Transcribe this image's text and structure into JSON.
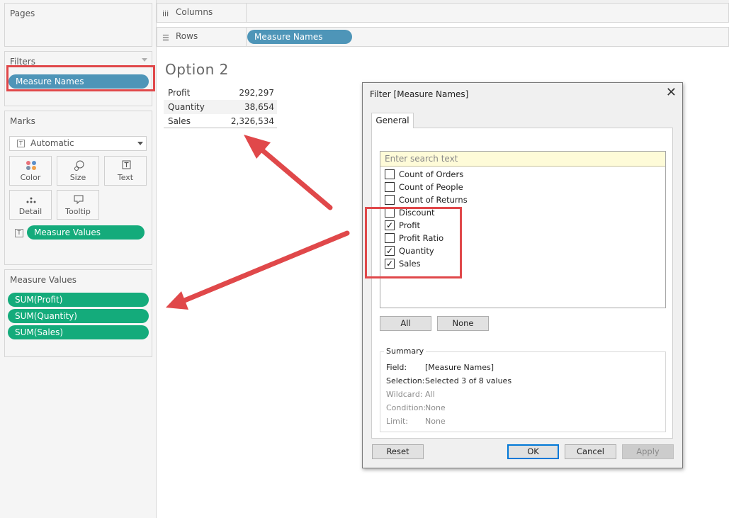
{
  "left_pane": {
    "pages": {
      "title": "Pages"
    },
    "filters": {
      "title": "Filters",
      "pill": "Measure Names"
    },
    "marks": {
      "title": "Marks",
      "mark_type": "Automatic",
      "buttons": [
        {
          "label": "Color",
          "icon": "color-dots-icon"
        },
        {
          "label": "Size",
          "icon": "size-icon"
        },
        {
          "label": "Text",
          "icon": "text-icon"
        },
        {
          "label": "Detail",
          "icon": "detail-icon"
        },
        {
          "label": "Tooltip",
          "icon": "tooltip-icon"
        }
      ],
      "text_pill": "Measure Values"
    },
    "measure_values": {
      "title": "Measure Values",
      "pills": [
        "SUM(Profit)",
        "SUM(Quantity)",
        "SUM(Sales)"
      ]
    }
  },
  "shelves": {
    "columns": {
      "label": "Columns"
    },
    "rows": {
      "label": "Rows",
      "pill": "Measure Names"
    }
  },
  "worksheet": {
    "title": "Option 2",
    "rows": [
      {
        "name": "Profit",
        "value": "292,297"
      },
      {
        "name": "Quantity",
        "value": "38,654"
      },
      {
        "name": "Sales",
        "value": "2,326,534"
      }
    ]
  },
  "dialog": {
    "title": "Filter [Measure Names]",
    "tab": "General",
    "search_placeholder": "Enter search text",
    "items": [
      {
        "label": "Count of Orders",
        "checked": false
      },
      {
        "label": "Count of People",
        "checked": false
      },
      {
        "label": "Count of Returns",
        "checked": false
      },
      {
        "label": "Discount",
        "checked": false
      },
      {
        "label": "Profit",
        "checked": true
      },
      {
        "label": "Profit Ratio",
        "checked": false
      },
      {
        "label": "Quantity",
        "checked": true
      },
      {
        "label": "Sales",
        "checked": true
      }
    ],
    "all_button": "All",
    "none_button": "None",
    "summary": {
      "legend": "Summary",
      "rows": [
        {
          "key": "Field:",
          "value": "[Measure Names]",
          "dim": false
        },
        {
          "key": "Selection:",
          "value": "Selected 3 of 8 values",
          "dim": false
        },
        {
          "key": "Wildcard:",
          "value": "All",
          "dim": true
        },
        {
          "key": "Condition:",
          "value": "None",
          "dim": true
        },
        {
          "key": "Limit:",
          "value": "None",
          "dim": true
        }
      ]
    },
    "reset_button": "Reset",
    "ok_button": "OK",
    "cancel_button": "Cancel",
    "apply_button": "Apply"
  },
  "colors": {
    "blue_pill": "#4e95b8",
    "green_pill": "#14ab7b",
    "annotation_red": "#e0484a"
  }
}
